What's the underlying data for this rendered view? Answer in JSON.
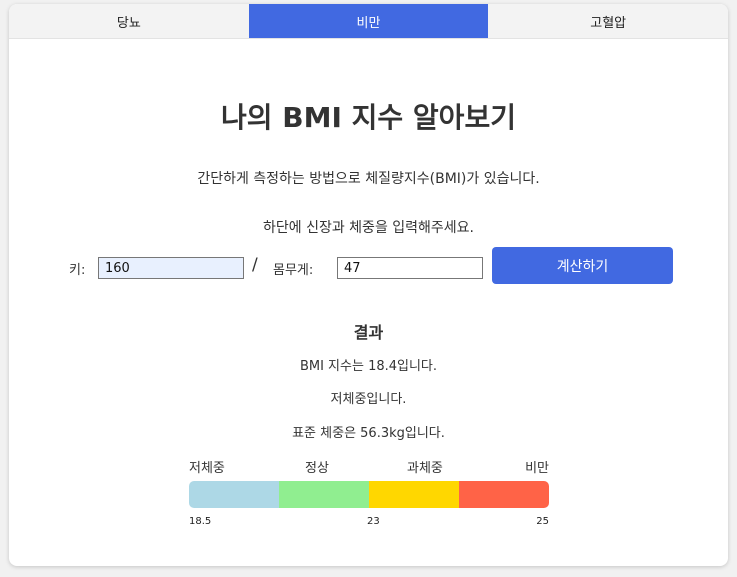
{
  "tabs": [
    {
      "label": "당뇨",
      "active": false
    },
    {
      "label": "비만",
      "active": true
    },
    {
      "label": "고혈압",
      "active": false
    }
  ],
  "colors": {
    "accent": "#4169e1",
    "scale": [
      "#add8e6",
      "#90ee90",
      "#ffd700",
      "#ff6347"
    ]
  },
  "main": {
    "title": "나의 BMI 지수 알아보기",
    "description1": "간단하게 측정하는 방법으로 체질량지수(BMI)가 있습니다.",
    "description2": "하단에 신장과 체중을 입력해주세요."
  },
  "form": {
    "height_label": "키:",
    "height_value": "160",
    "separator": "/",
    "weight_label": "몸무게:",
    "weight_value": "47",
    "calculate_label": "계산하기"
  },
  "result": {
    "title": "결과",
    "bmi_text": "BMI 지수는 18.4입니다.",
    "category_text": "저체중입니다.",
    "standard_weight_text": "표준 체중은 56.3kg입니다."
  },
  "scale": {
    "categories": [
      "저체중",
      "정상",
      "과체중",
      "비만"
    ],
    "thresholds": [
      "18.5",
      "23",
      "25"
    ]
  }
}
